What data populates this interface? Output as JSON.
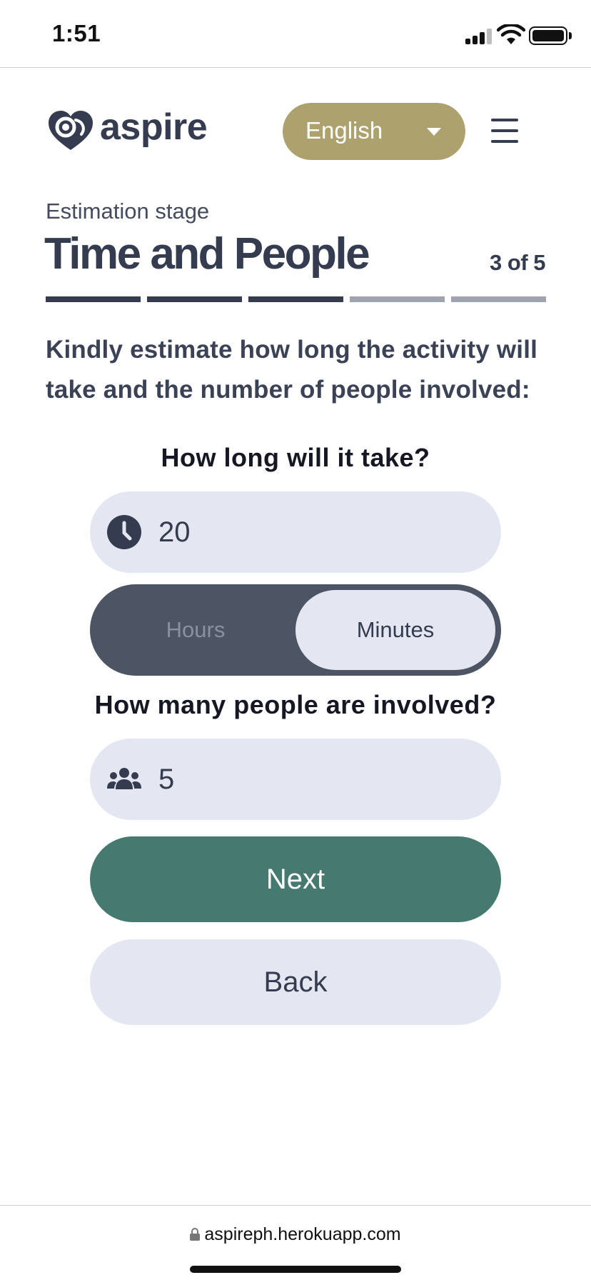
{
  "status_bar": {
    "time": "1:51"
  },
  "header": {
    "logo_text": "aspire",
    "language": {
      "selected": "English"
    }
  },
  "stage": {
    "label": "Estimation stage",
    "title": "Time and People",
    "step_text": "3 of 5",
    "current_step": 3,
    "total_steps": 5
  },
  "instructions": "Kindly estimate how long the activity will take and the number of people involved:",
  "duration": {
    "question": "How long will it take?",
    "value": "20",
    "unit_options": [
      "Hours",
      "Minutes"
    ],
    "selected_unit": "Minutes"
  },
  "people": {
    "question": "How many people are involved?",
    "value": "5"
  },
  "buttons": {
    "next": "Next",
    "back": "Back"
  },
  "browser": {
    "url": "aspireph.herokuapp.com"
  },
  "colors": {
    "primary_dark": "#353c50",
    "accent_gold": "#ada26e",
    "next_green": "#467a71",
    "field_bg": "#e4e7f1",
    "toggle_bg": "#4d5463",
    "progress_done": "#353c50",
    "progress_todo": "#9ea3af"
  },
  "icons": [
    "heart-logo-icon",
    "caret-down-icon",
    "hamburger-menu-icon",
    "clock-icon",
    "people-icon",
    "lock-icon"
  ]
}
